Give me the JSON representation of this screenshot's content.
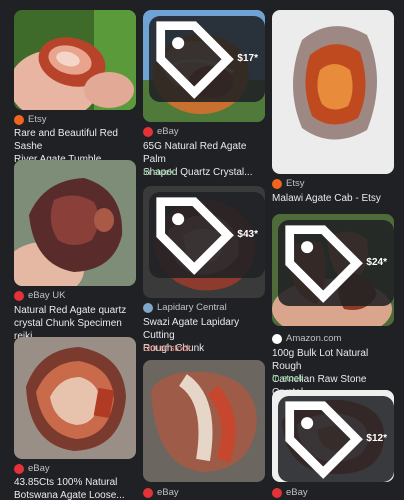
{
  "results": [
    {
      "source": "Etsy",
      "title_lines": [
        "Rare and Beautiful Red Sashe",
        "River Agate Tumble. Banded..."
      ],
      "price": "",
      "stock": ""
    },
    {
      "source": "eBay",
      "title_lines": [
        "65G Natural Red Agate Palm",
        "Shaped Quartz Crystal..."
      ],
      "price": "$17*",
      "stock": "In stock"
    },
    {
      "source": "Etsy",
      "title_lines": [
        "Malawi Agate Cab - Etsy"
      ],
      "price": "",
      "stock": ""
    },
    {
      "source": "eBay UK",
      "title_lines": [
        "Natural Red Agate quartz",
        "crystal Chunk Specimen reiki..."
      ],
      "price": "",
      "stock": ""
    },
    {
      "source": "Lapidary Central",
      "title_lines": [
        "Swazi Agate Lapidary Cutting",
        "Rough Chunk"
      ],
      "price": "$43*",
      "stock": "Out of stock"
    },
    {
      "source": "Amazon.com",
      "title_lines": [
        "100g Bulk Lot Natural Rough",
        "Carnelian Raw Stone Crystal..."
      ],
      "price": "$24*",
      "stock": "In stock"
    },
    {
      "source": "eBay",
      "title_lines": [
        "43.85Cts 100% Natural",
        "Botswana Agate Loose..."
      ],
      "price": "",
      "stock": ""
    },
    {
      "source": "eBay",
      "title_lines": [],
      "price": "",
      "stock": ""
    },
    {
      "source": "eBay",
      "title_lines": [],
      "price": "$12*",
      "stock": ""
    }
  ],
  "colors": {
    "background": "#202124",
    "in_stock": "#81c995",
    "out_of_stock": "#f28b82",
    "etsy": "#f1641e",
    "ebay": "#e53238",
    "lapidary": "#7fa7c9",
    "amazon": "#ffffff"
  },
  "icons": {
    "price": "tag-icon",
    "source": "favicon"
  }
}
